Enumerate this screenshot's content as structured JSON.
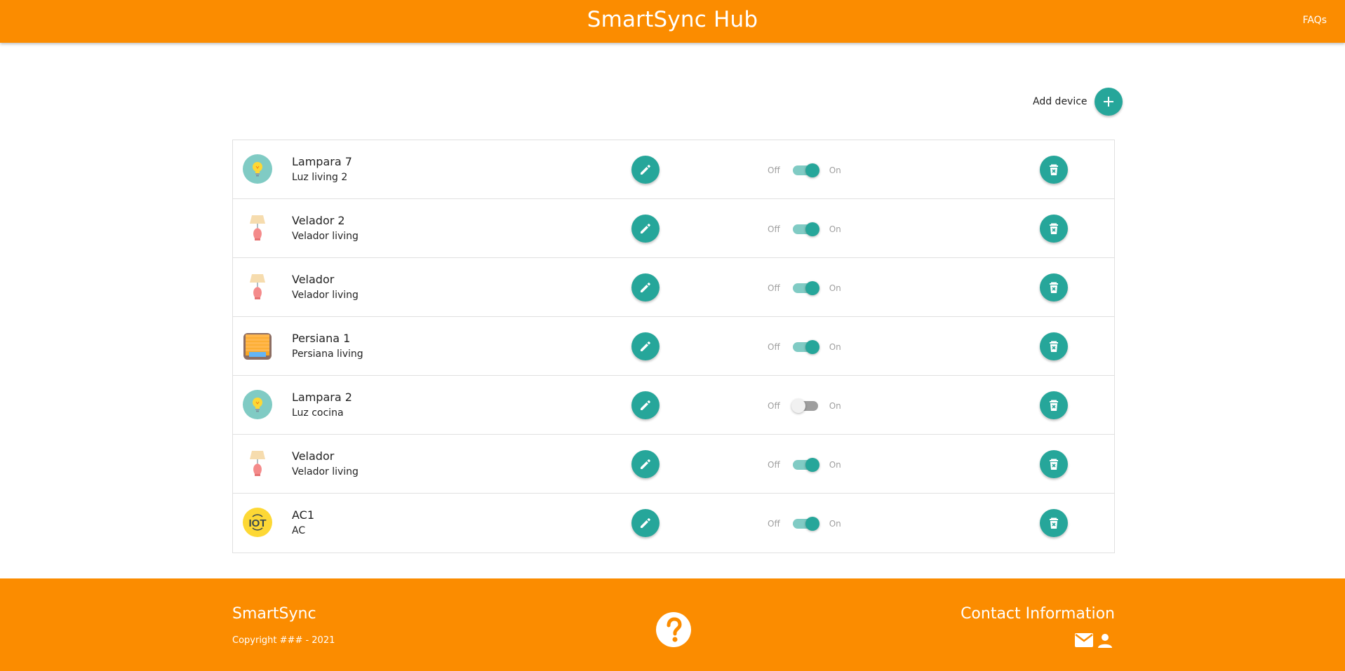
{
  "header": {
    "title": "SmartSync Hub",
    "faqs_label": "FAQs"
  },
  "toolbar": {
    "add_device_label": "Add device"
  },
  "switch_labels": {
    "off": "Off",
    "on": "On"
  },
  "devices": [
    {
      "name": "Lampara 7",
      "description": "Luz living 2",
      "icon": "light-bulb-icon",
      "state": "on"
    },
    {
      "name": "Velador 2",
      "description": "Velador living",
      "icon": "table-lamp-icon",
      "state": "on"
    },
    {
      "name": "Velador",
      "description": "Velador living",
      "icon": "table-lamp-icon",
      "state": "on"
    },
    {
      "name": "Persiana 1",
      "description": "Persiana living",
      "icon": "window-blind-icon",
      "state": "on"
    },
    {
      "name": "Lampara 2",
      "description": "Luz cocina",
      "icon": "light-bulb-icon",
      "state": "off"
    },
    {
      "name": "Velador",
      "description": "Velador living",
      "icon": "table-lamp-icon",
      "state": "on"
    },
    {
      "name": "AC1",
      "description": "AC",
      "icon": "iot-icon",
      "state": "on"
    }
  ],
  "footer": {
    "brand": "SmartSync",
    "copyright": "Copyright ### - 2021",
    "contact_title": "Contact Information"
  },
  "colors": {
    "brand_orange": "#fb8c00",
    "accent_teal": "#26a69a"
  }
}
